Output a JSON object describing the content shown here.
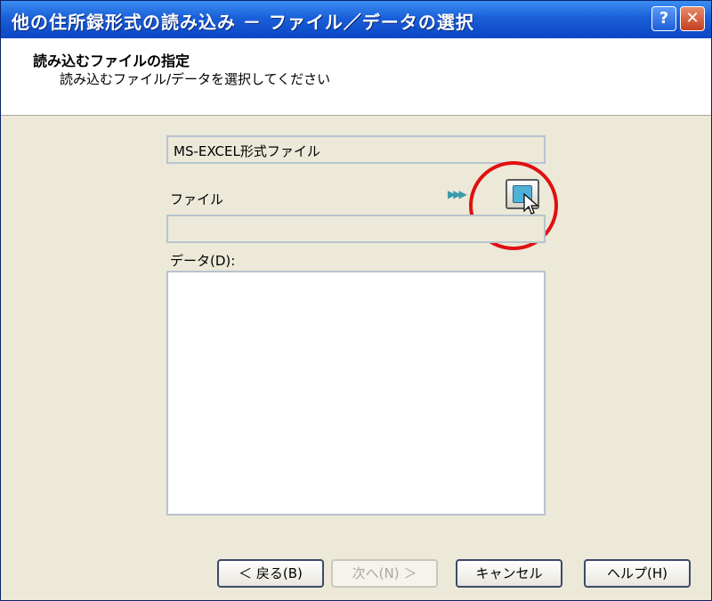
{
  "window": {
    "title": "他の住所録形式の読み込み － ファイル／データの選択",
    "help_glyph": "?",
    "close_glyph": "✕"
  },
  "header": {
    "title": "読み込むファイルの指定",
    "subtitle": "読み込むファイル/データを選択してください"
  },
  "format": {
    "value": "MS-EXCEL形式ファイル"
  },
  "file": {
    "label": "ファイル",
    "value": "",
    "arrows": "▶▶▶",
    "browse_icon": "folder-browse-icon"
  },
  "data": {
    "label": "データ(D):",
    "items": []
  },
  "buttons": {
    "back": "＜ 戻る(B)",
    "next": "次へ(N) ＞",
    "cancel": "キャンセル",
    "help": "ヘルプ(H)"
  },
  "colors": {
    "titlebar": "#0b46c4",
    "dialog_bg": "#ece9d8",
    "highlight_circle": "#e01010"
  }
}
